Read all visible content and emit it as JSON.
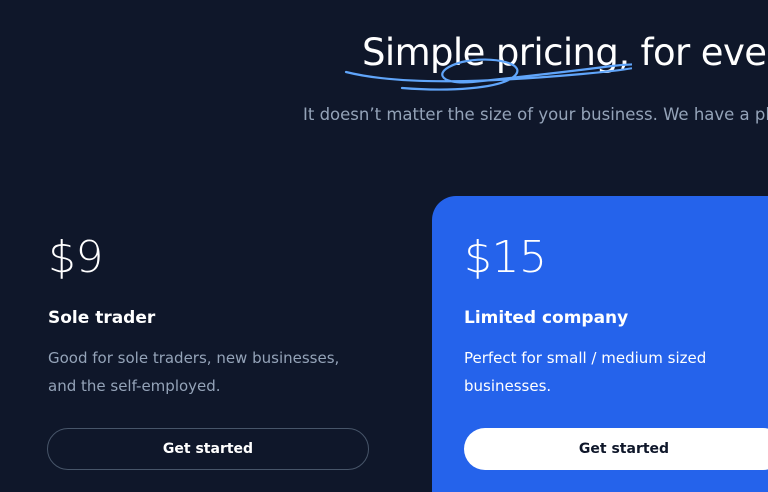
{
  "hero": {
    "title": "Simple pricing, for everyone.",
    "subtitle": "It doesn’t matter the size of your business. We have a plan for you."
  },
  "plans": [
    {
      "price": "$9",
      "name": "Sole trader",
      "description": "Good for sole traders, new businesses, and the self-employed.",
      "cta_label": "Get started"
    },
    {
      "price": "$15",
      "name": "Limited company",
      "description": "Perfect for small / medium sized businesses.",
      "cta_label": "Get started"
    }
  ],
  "colors": {
    "background": "#0f172a",
    "featured_card": "#2563eb",
    "muted_text": "#94a3b8",
    "swoosh": "#60a5fa"
  }
}
